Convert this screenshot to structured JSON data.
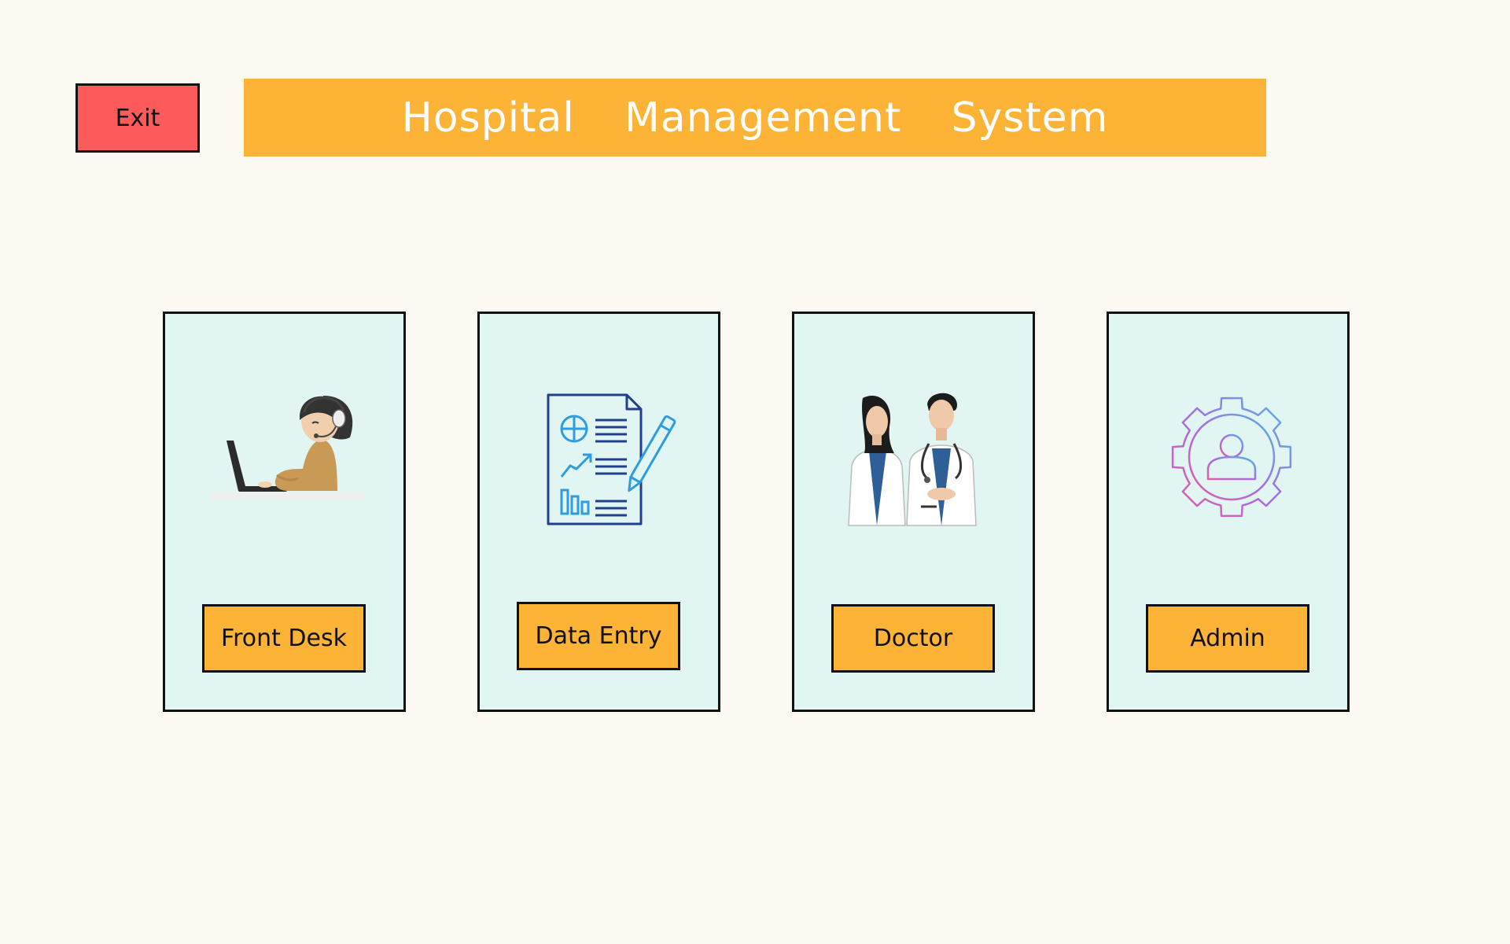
{
  "header": {
    "exit_label": "Exit",
    "title": "Hospital  Management  System"
  },
  "colors": {
    "background": "#fbf9f1",
    "banner": "#fdb436",
    "exit": "#fd5a5c",
    "card": "#e1f5f2",
    "button": "#fdb436"
  },
  "roles": [
    {
      "label": "Front Desk",
      "icon": "receptionist-headset-laptop-icon"
    },
    {
      "label": "Data Entry",
      "icon": "report-document-pencil-icon"
    },
    {
      "label": "Doctor",
      "icon": "doctors-illustration-icon"
    },
    {
      "label": "Admin",
      "icon": "admin-gear-user-icon"
    }
  ]
}
